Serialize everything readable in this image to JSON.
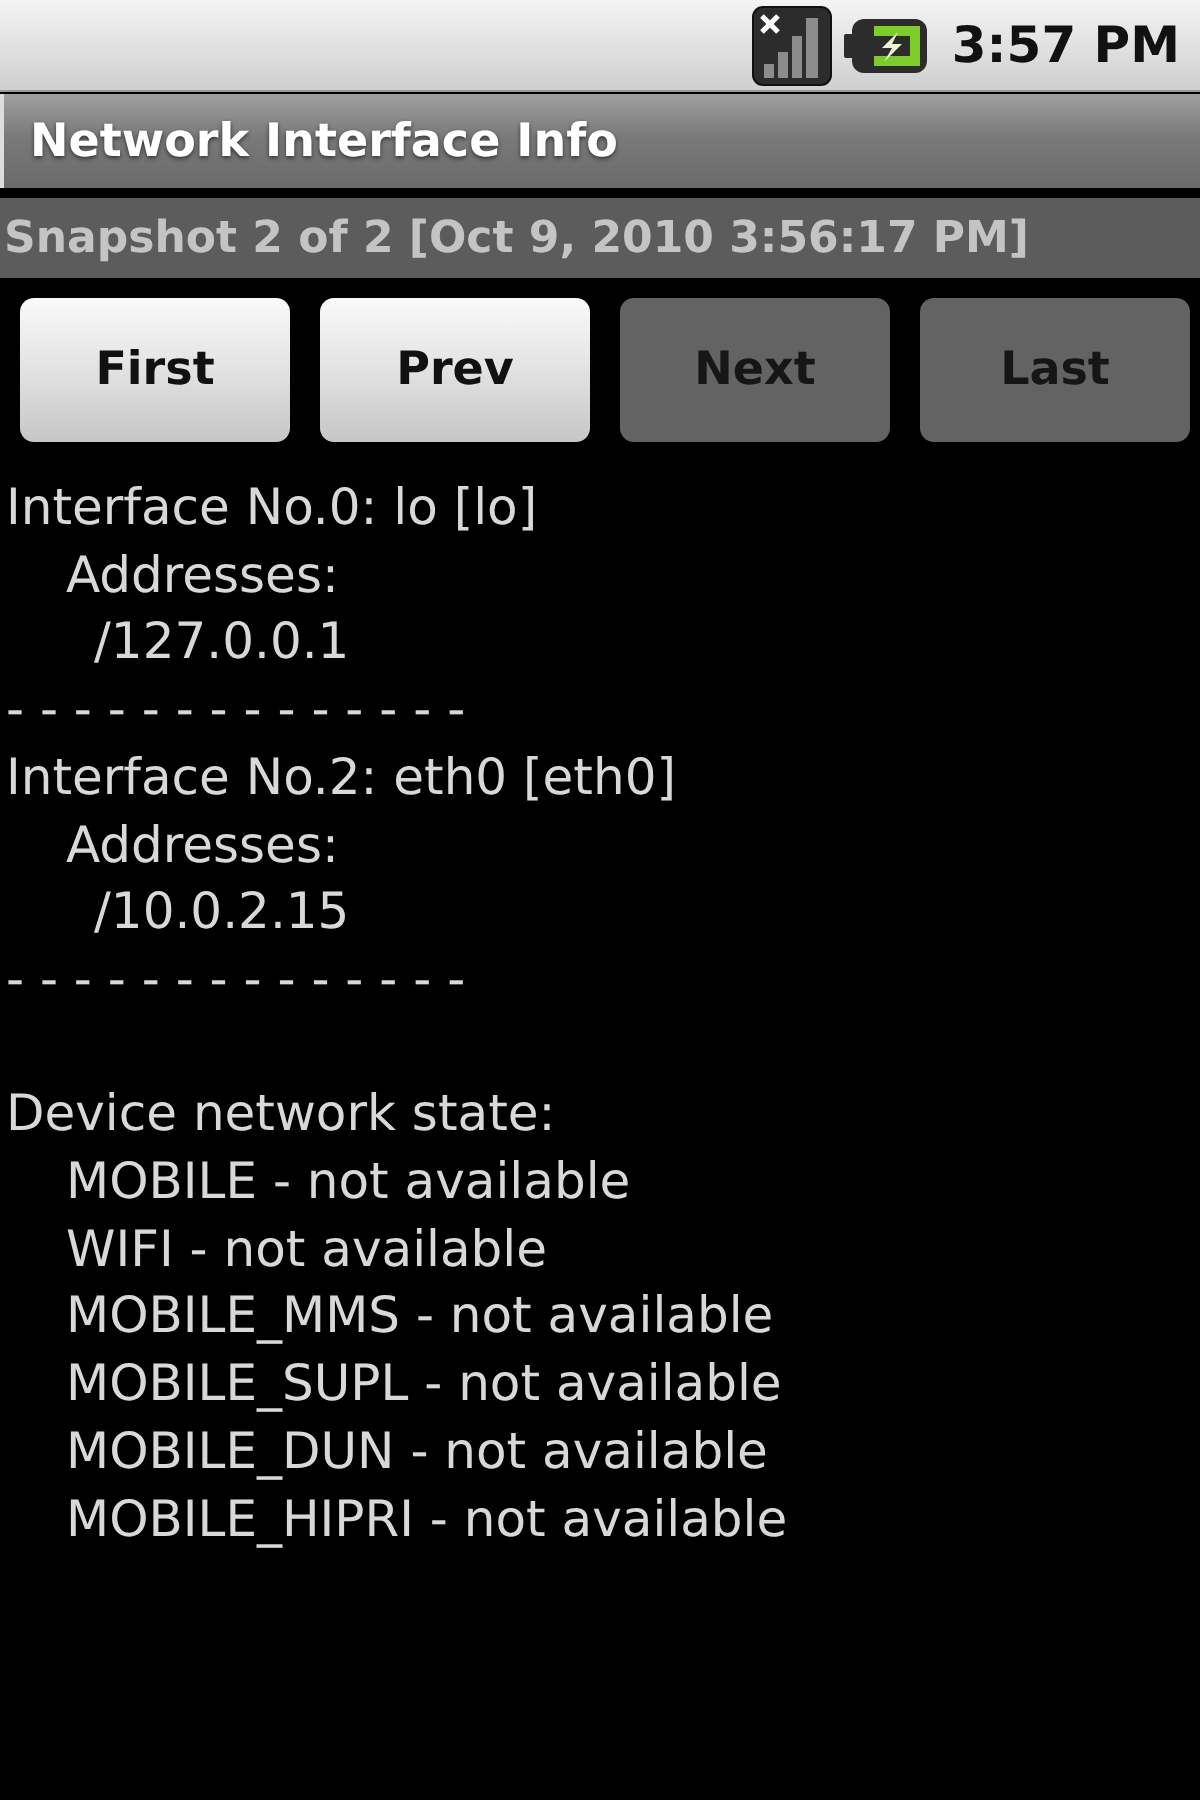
{
  "status_bar": {
    "time": "3:57 PM"
  },
  "title_bar": {
    "title": "Network Interface Info"
  },
  "snapshot_bar": {
    "text": "Snapshot 2 of 2 [Oct 9, 2010 3:56:17 PM]"
  },
  "buttons": [
    {
      "label": "First",
      "disabled": false
    },
    {
      "label": "Prev",
      "disabled": false
    },
    {
      "label": "Next",
      "disabled": true
    },
    {
      "label": "Last",
      "disabled": true
    }
  ],
  "interfaces": [
    {
      "heading": "Interface No.0: lo [lo]",
      "addresses_label": "Addresses:",
      "addresses": [
        "/127.0.0.1"
      ],
      "separator": "- - - - - - - - - - - - - -"
    },
    {
      "heading": "Interface No.2: eth0 [eth0]",
      "addresses_label": "Addresses:",
      "addresses": [
        "/10.0.2.15"
      ],
      "separator": "- - - - - - - - - - - - - -"
    }
  ],
  "network_state": {
    "heading": "Device network state:",
    "items": [
      "MOBILE - not available",
      "WIFI - not available",
      "MOBILE_MMS - not available",
      "MOBILE_SUPL - not available",
      "MOBILE_DUN - not available",
      "MOBILE_HIPRI - not available"
    ]
  }
}
